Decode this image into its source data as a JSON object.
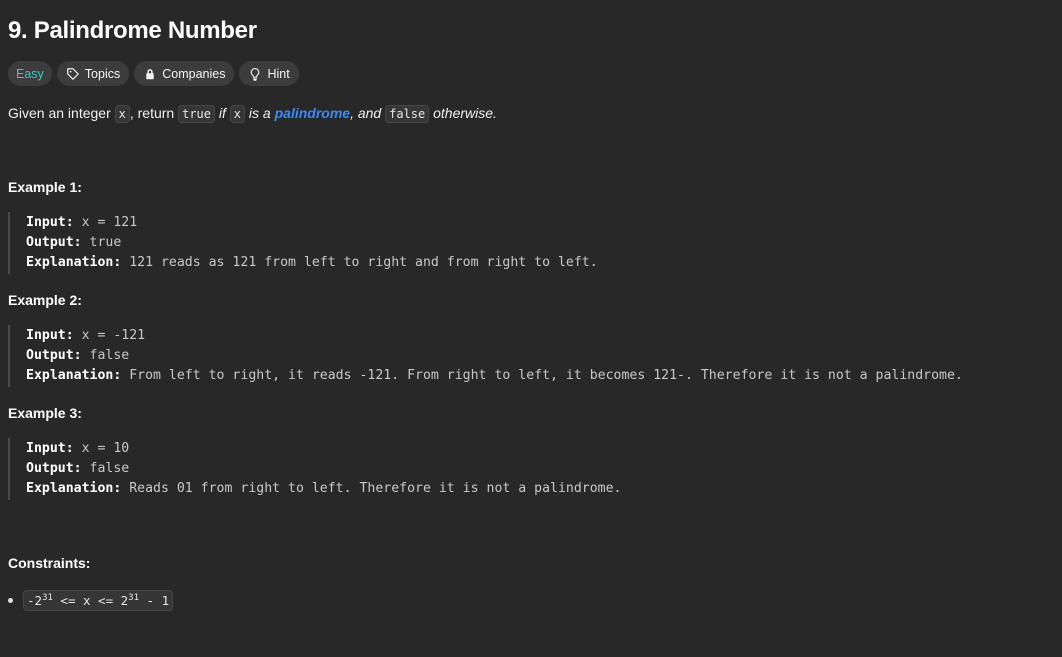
{
  "problem": {
    "title": "9. Palindrome Number"
  },
  "tags": {
    "difficulty": "Easy",
    "topics": "Topics",
    "companies": "Companies",
    "hint": "Hint"
  },
  "description": {
    "part1": "Given an integer ",
    "code_x1": "x",
    "part2": ", return ",
    "code_true": "true",
    "part3": " if ",
    "code_x2": "x",
    "part4": " is a ",
    "link_palindrome": "palindrome",
    "part5": ", and ",
    "code_false": "false",
    "part6": " otherwise."
  },
  "examples": [
    {
      "title": "Example 1:",
      "input_label": "Input:",
      "input": " x = 121",
      "output_label": "Output:",
      "output": " true",
      "explanation_label": "Explanation:",
      "explanation": " 121 reads as 121 from left to right and from right to left."
    },
    {
      "title": "Example 2:",
      "input_label": "Input:",
      "input": " x = -121",
      "output_label": "Output:",
      "output": " false",
      "explanation_label": "Explanation:",
      "explanation": " From left to right, it reads -121. From right to left, it becomes 121-. Therefore it is not a palindrome."
    },
    {
      "title": "Example 3:",
      "input_label": "Input:",
      "input": " x = 10",
      "output_label": "Output:",
      "output": " false",
      "explanation_label": "Explanation:",
      "explanation": " Reads 01 from right to left. Therefore it is not a palindrome."
    }
  ],
  "constraints": {
    "title": "Constraints:",
    "items": [
      {
        "prefix": "-2",
        "exp1": "31",
        "middle": " <= x <= 2",
        "exp2": "31",
        "suffix": " - 1"
      }
    ]
  },
  "colors": {
    "background": "#282828",
    "easy": "#46c6c2",
    "link": "#3e8bf0"
  },
  "icons": {
    "topics": "tag-icon",
    "companies": "lock-icon",
    "hint": "lightbulb-icon"
  }
}
